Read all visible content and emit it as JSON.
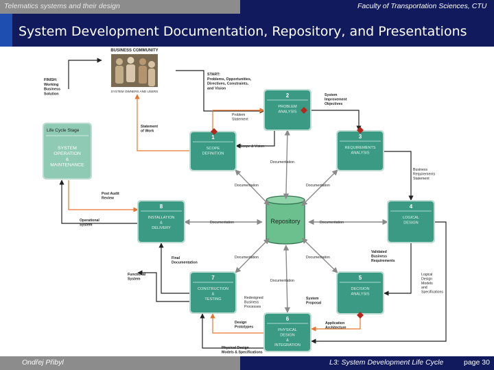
{
  "header": {
    "left": "Telematics systems and their design",
    "right": "Faculty of Transportation Sciences, CTU"
  },
  "title": "System Development Documentation, Repository, and Presentations",
  "footer": {
    "author": "Ondřej Přibyl",
    "lecture": "L3: System Development Life Cycle",
    "page": "page 30"
  },
  "diagram": {
    "community": {
      "title": "BUSINESS COMMUNITY",
      "caption": "SYSTEM OWNERS AND USERS"
    },
    "finish_lines": [
      "FINISH:",
      "Working",
      "Business",
      "Solution"
    ],
    "start_lines": [
      "START:",
      "Problems, Opportunities,",
      "Directives, Constraints,",
      "and Vision"
    ],
    "lifecycle": {
      "label": "Life Cycle Stage",
      "lines": [
        "SYSTEM",
        "OPERATION",
        "&",
        "MAINTENANCE"
      ]
    },
    "repository": "Repository",
    "phases": [
      {
        "num": "1",
        "lines": [
          "SCOPE",
          "DEFINITION"
        ]
      },
      {
        "num": "2",
        "lines": [
          "PROBLEM",
          "ANALYSIS"
        ]
      },
      {
        "num": "3",
        "lines": [
          "REQUIREMENTS",
          "ANALYSIS"
        ]
      },
      {
        "num": "4",
        "lines": [
          "LOGICAL",
          "DESIGN"
        ]
      },
      {
        "num": "5",
        "lines": [
          "DECISION",
          "ANALYSIS"
        ]
      },
      {
        "num": "6",
        "lines": [
          "PHYSICAL",
          "DESIGN",
          "&",
          "INTEGRATION"
        ]
      },
      {
        "num": "7",
        "lines": [
          "CONSTRUCTION",
          "&",
          "TESTING"
        ]
      },
      {
        "num": "8",
        "lines": [
          "INSTALLATION",
          "&",
          "DELIVERY"
        ]
      }
    ],
    "labels": {
      "system_improvement": [
        "System",
        "Improvement",
        "Objectives"
      ],
      "problem_statement": [
        "Problem",
        "Statement"
      ],
      "statement_of_work": [
        "Statement",
        "of Work"
      ],
      "scope_vision": [
        "Scope & Vision"
      ],
      "business_requirements": [
        "Business",
        "Requirements",
        "Statement"
      ],
      "post_audit": [
        "Post Audit",
        "Review"
      ],
      "operational_system": [
        "Operational",
        "System"
      ],
      "validated": [
        "Validated",
        "Business",
        "Requirements"
      ],
      "logical_design": [
        "Logical",
        "Design",
        "Models",
        "and",
        "Specifications"
      ],
      "functional_system": [
        "Functional",
        "System"
      ],
      "final_documentation": [
        "Final",
        "Documentation"
      ],
      "redesigned": [
        "Redesigned",
        "Business",
        "Processes"
      ],
      "system_proposal": [
        "System",
        "Proposal"
      ],
      "application_arch": [
        "Application",
        "Architecture"
      ],
      "design_prototypes": [
        "Design",
        "Prototypes"
      ],
      "physical_design_models": [
        "Physical Design",
        "Models & Specifications"
      ],
      "doc_1": [
        "Documentation"
      ],
      "doc_2": [
        "Documentation"
      ],
      "doc_3": [
        "Documentation"
      ],
      "doc_4": [
        "Documentation"
      ],
      "doc_5": [
        "Documentation"
      ],
      "doc_6": [
        "Documentation"
      ],
      "doc_7": [
        "Documentation"
      ],
      "doc_8": [
        "Documentation"
      ]
    }
  }
}
